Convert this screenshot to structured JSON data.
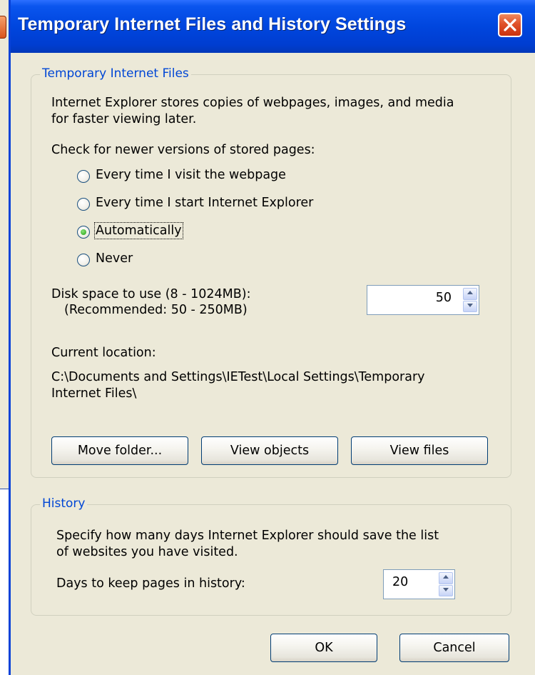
{
  "window": {
    "title": "Temporary Internet Files and History Settings"
  },
  "tif_group": {
    "legend": "Temporary Internet Files",
    "description_line1": "Internet Explorer stores copies of webpages, images, and media",
    "description_line2": "for faster viewing later.",
    "check_label": "Check for newer versions of stored pages:",
    "options": [
      {
        "label": "Every time I visit the webpage",
        "checked": false
      },
      {
        "label": "Every time I start Internet Explorer",
        "checked": false
      },
      {
        "label": "Automatically",
        "checked": true
      },
      {
        "label": "Never",
        "checked": false
      }
    ],
    "disk_space_label": "Disk space to use (8 - 1024MB):",
    "recommended_label": "(Recommended: 50 - 250MB)",
    "disk_space_value": "50",
    "current_location_label": "Current location:",
    "location_line1": "C:\\Documents and Settings\\IETest\\Local Settings\\Temporary",
    "location_line2": "Internet Files\\",
    "buttons": {
      "move_folder": "Move folder...",
      "view_objects": "View objects",
      "view_files": "View files"
    }
  },
  "history_group": {
    "legend": "History",
    "description_line1": "Specify how many days Internet Explorer should save the list",
    "description_line2": "of websites you have visited.",
    "days_label": "Days to keep pages in history:",
    "days_value": "20"
  },
  "footer": {
    "ok_label": "OK",
    "cancel_label": "Cancel"
  },
  "icons": {
    "close": "close-icon",
    "radio": "radio-button-icon",
    "spin": "spin-arrows-icon"
  },
  "colors": {
    "titlebar": "#0046de",
    "client_bg": "#ece9d8",
    "group_legend": "#0046d5",
    "close_button": "#e0522a"
  }
}
